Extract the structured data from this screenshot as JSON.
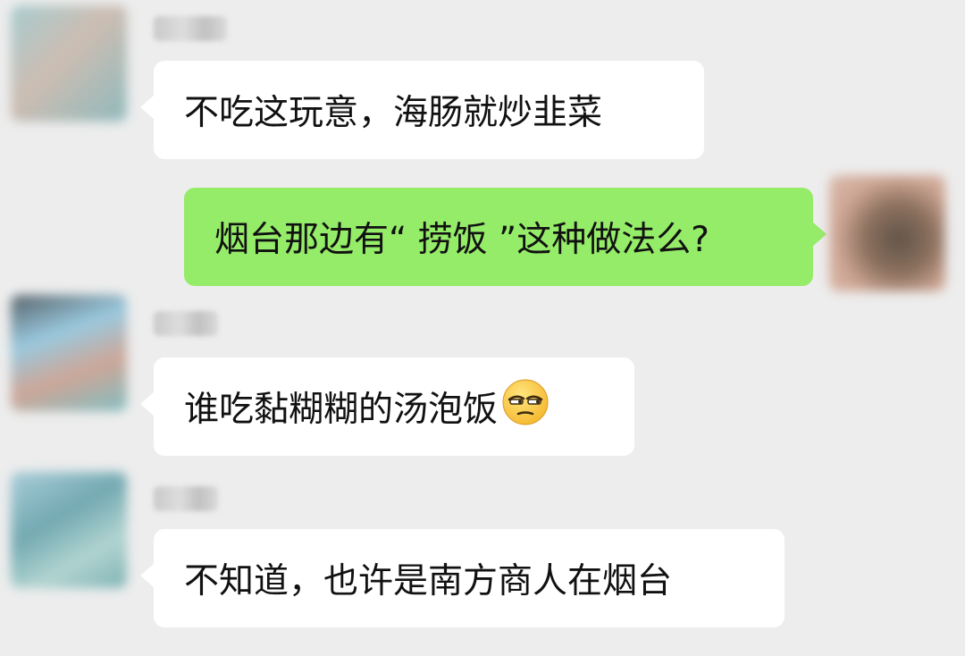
{
  "messages": [
    {
      "side": "received",
      "text": "不吃这玩意，海肠就炒韭菜"
    },
    {
      "side": "sent",
      "text": "烟台那边有“ 捞饭 ”这种做法么?"
    },
    {
      "side": "received",
      "text": "谁吃黏糊糊的汤泡饭",
      "emoji": "unamused-face-emoji"
    },
    {
      "side": "received",
      "text": "不知道，也许是南方商人在烟台"
    }
  ],
  "colors": {
    "background": "#ededed",
    "received_bubble": "#ffffff",
    "sent_bubble": "#95ec69"
  },
  "icons": {
    "avatar": "blurred-avatar",
    "emoji": "unamused-face-emoji"
  }
}
